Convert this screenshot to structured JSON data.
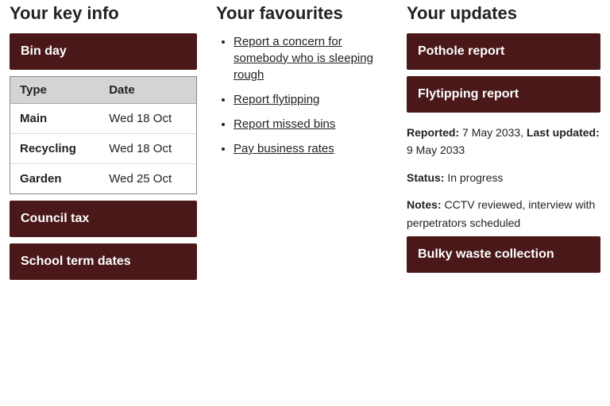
{
  "col1": {
    "title": "Your key info",
    "bin_day_label": "Bin day",
    "table": {
      "headers": [
        "Type",
        "Date"
      ],
      "rows": [
        {
          "type": "Main",
          "date": "Wed 18 Oct"
        },
        {
          "type": "Recycling",
          "date": "Wed 18 Oct"
        },
        {
          "type": "Garden",
          "date": "Wed 25 Oct"
        }
      ]
    },
    "buttons": [
      {
        "label": "Council tax"
      },
      {
        "label": "School term dates"
      }
    ]
  },
  "col2": {
    "title": "Your favourites",
    "items": [
      {
        "text": "Report a concern for somebody who is sleeping rough"
      },
      {
        "text": "Report flytipping"
      },
      {
        "text": "Report missed bins"
      },
      {
        "text": "Pay business rates"
      }
    ]
  },
  "col3": {
    "title": "Your updates",
    "updates": [
      {
        "label": "Pothole report"
      },
      {
        "label": "Flytipping report"
      }
    ],
    "meta": {
      "reported_label": "Reported:",
      "reported_value": "7 May 2033,",
      "updated_label": "Last updated:",
      "updated_value": "9 May 2033",
      "status_label": "Status:",
      "status_value": "In progress",
      "notes_label": "Notes:",
      "notes_value": "CCTV reviewed, interview with perpetrators scheduled"
    },
    "bottom_button": {
      "label": "Bulky waste collection"
    }
  }
}
